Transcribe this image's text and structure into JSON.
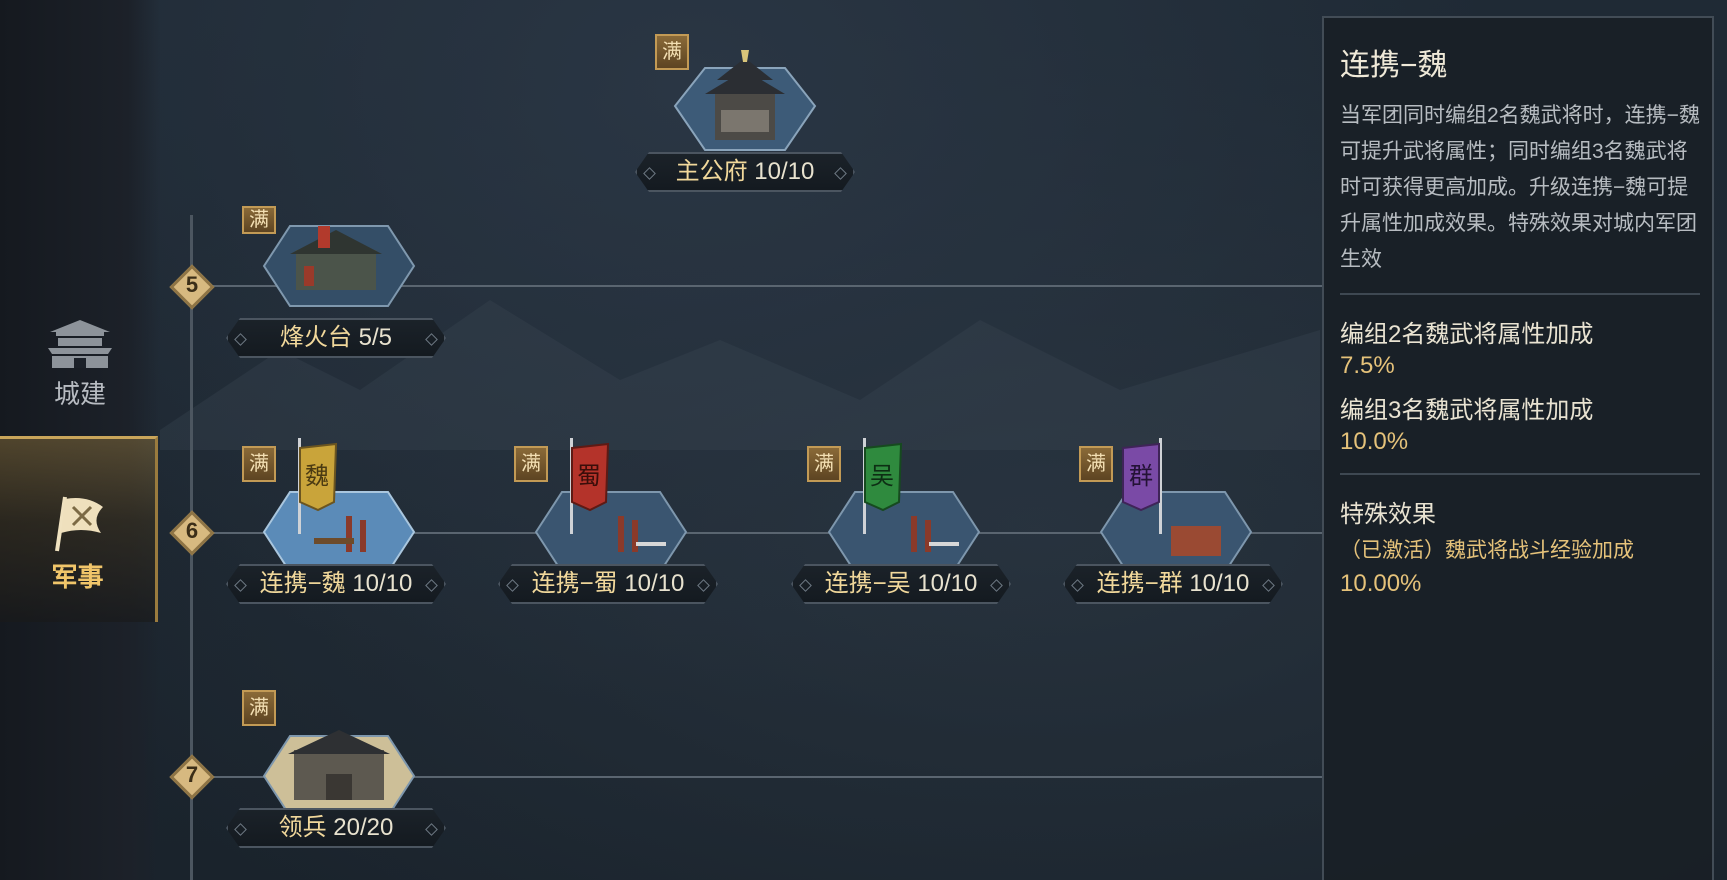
{
  "nav": {
    "city_label": "城建",
    "military_label": "军事"
  },
  "badge_text": "满",
  "tiers": [
    "5",
    "6",
    "7"
  ],
  "nodes": {
    "main_hall": {
      "name": "主公府",
      "progress": "10/10"
    },
    "beacon": {
      "name": "烽火台",
      "progress": "5/5"
    },
    "wei": {
      "name": "连携−魏",
      "progress": "10/10",
      "flag_char": "魏",
      "flag_color": "#c9a43a"
    },
    "shu": {
      "name": "连携−蜀",
      "progress": "10/10",
      "flag_char": "蜀",
      "flag_color": "#b4332a"
    },
    "wu": {
      "name": "连携−吴",
      "progress": "10/10",
      "flag_char": "吴",
      "flag_color": "#2f8a3e"
    },
    "qun": {
      "name": "连携−群",
      "progress": "10/10",
      "flag_char": "群",
      "flag_color": "#7a4aa6"
    },
    "troops": {
      "name": "领兵",
      "progress": "20/20"
    }
  },
  "panel": {
    "title": "连携−魏",
    "description": "当军团同时编组2名魏武将时，连携−魏可提升武将属性；同时编组3名魏武将时可获得更高加成。升级连携−魏可提升属性加成效果。特殊效果对城内军团生效",
    "stat1_label": "编组2名魏武将属性加成",
    "stat1_value": "7.5%",
    "stat2_label": "编组3名魏武将属性加成",
    "stat2_value": "10.0%",
    "special_title": "特殊效果",
    "special_desc": "（已激活）魏武将战斗经验加成",
    "special_value": "10.00%"
  },
  "colors": {
    "accent_gold": "#e5c27a",
    "active_nav": "#f0c56a"
  }
}
